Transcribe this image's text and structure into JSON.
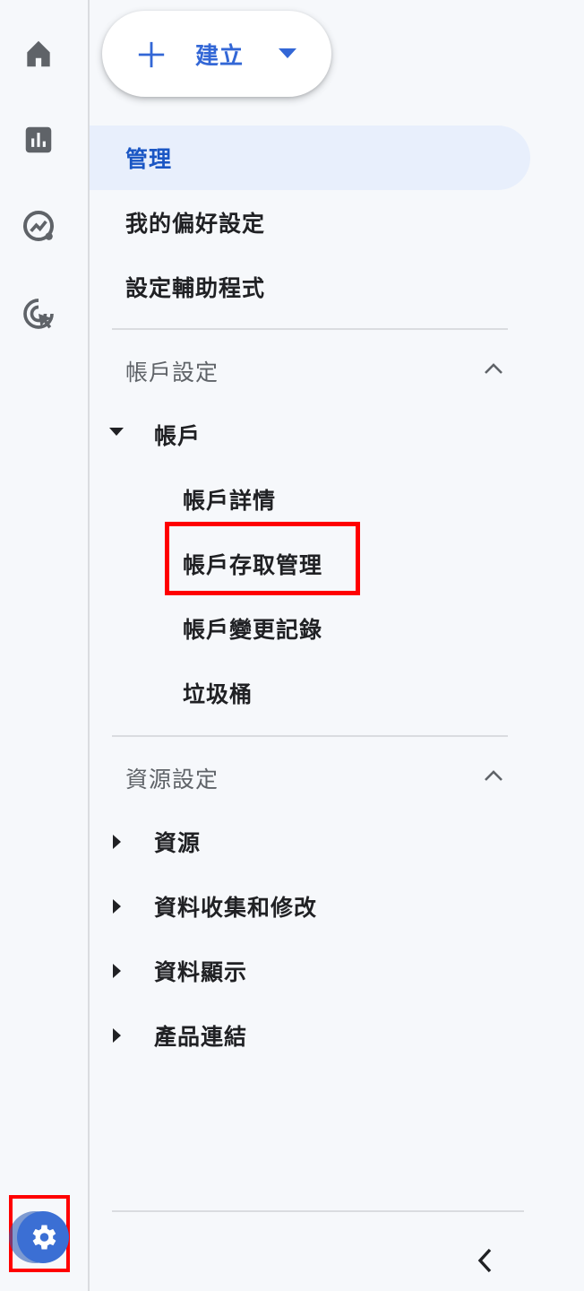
{
  "rail": {
    "items": [
      {
        "icon": "home-icon"
      },
      {
        "icon": "reports-bar-chart-icon"
      },
      {
        "icon": "explore-trend-icon"
      },
      {
        "icon": "advertising-target-icon"
      }
    ],
    "settings_icon": "gear-icon"
  },
  "create": {
    "label": "建立",
    "icon": "plus-icon",
    "dropdown_icon": "caret-down-icon"
  },
  "nav": {
    "top_items": [
      {
        "label": "管理",
        "active": true
      },
      {
        "label": "我的偏好設定"
      },
      {
        "label": "設定輔助程式"
      }
    ],
    "account_section": {
      "title": "帳戶設定",
      "expanded": true,
      "group": {
        "label": "帳戶",
        "expanded": true,
        "children": [
          {
            "label": "帳戶詳情"
          },
          {
            "label": "帳戶存取管理",
            "highlighted": true
          },
          {
            "label": "帳戶變更記錄"
          },
          {
            "label": "垃圾桶"
          }
        ]
      }
    },
    "property_section": {
      "title": "資源設定",
      "expanded": true,
      "items": [
        {
          "label": "資源"
        },
        {
          "label": "資料收集和修改"
        },
        {
          "label": "資料顯示"
        },
        {
          "label": "產品連結"
        }
      ]
    },
    "collapse_icon": "chevron-left-icon"
  },
  "colors": {
    "accent": "#1a56c4",
    "active_bg": "#e8effc",
    "highlight": "#ff0000",
    "settings_bg": "#3b6fd4"
  }
}
